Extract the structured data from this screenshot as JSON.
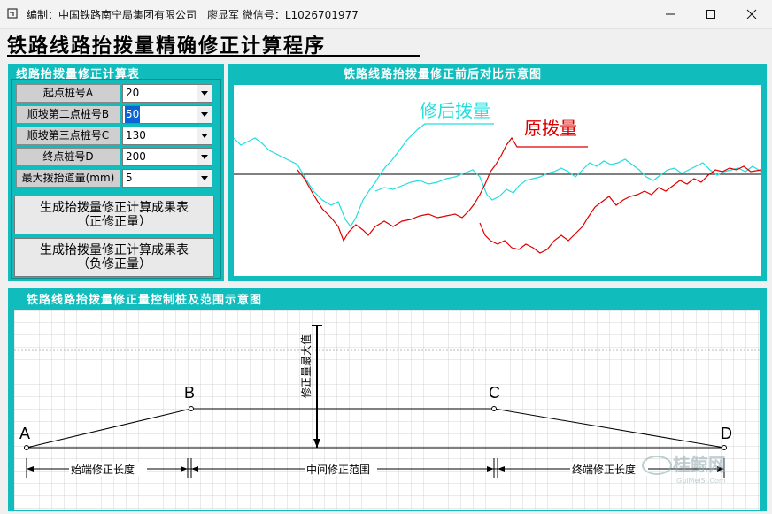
{
  "window": {
    "title": "编制：中国铁路南宁局集团有限公司　廖显军 微信号：L1026701977",
    "app_title": "铁路线路抬拨量精确修正计算程序"
  },
  "params_panel": {
    "title": "线路抬拨量修正计算表",
    "fields": [
      {
        "label": "起点桩号A",
        "value": "20",
        "selected": false
      },
      {
        "label": "顺坡第二点桩号B",
        "value": "50",
        "selected": true
      },
      {
        "label": "顺坡第三点桩号C",
        "value": "130",
        "selected": false
      },
      {
        "label": "终点桩号D",
        "value": "200",
        "selected": false
      },
      {
        "label": "最大拨抬道量(mm)",
        "value": "5",
        "selected": false
      }
    ],
    "button_positive": {
      "line1": "生成抬拨量修正计算成果表",
      "line2": "（正修正量）"
    },
    "button_negative": {
      "line1": "生成抬拨量修正计算成果表",
      "line2": "（负修正量）"
    }
  },
  "compare_panel": {
    "title": "铁路线路抬拨量修正前后对比示意图",
    "legend_after": "修后拨量",
    "legend_before": "原拨量",
    "color_after": "#22dede",
    "color_before": "#dd0000"
  },
  "range_panel": {
    "title": "铁路线路抬拨量修正量控制桩及范围示意图",
    "points": {
      "a": "A",
      "b": "B",
      "c": "C",
      "d": "D"
    },
    "max_label": "修正量最大值",
    "seg_start": "始端修正长度",
    "seg_middle": "中间修正范围",
    "seg_end": "终端修正长度"
  },
  "watermark": {
    "text": "桂鲸网",
    "sub": "GuiMeiSi.Com"
  },
  "colors": {
    "panel": "#11bcbc"
  }
}
